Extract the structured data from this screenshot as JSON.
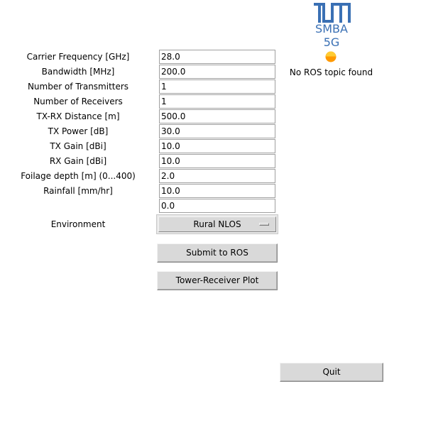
{
  "logo": {
    "line1": "SMBA",
    "line2": "5G",
    "color": "#3a70b4"
  },
  "status": {
    "text": "No ROS topic found",
    "indicator_color": "#ff9900"
  },
  "form": {
    "fields": [
      {
        "label": "Carrier Frequency [GHz]",
        "value": "28.0"
      },
      {
        "label": "Bandwidth [MHz]",
        "value": "200.0"
      },
      {
        "label": "Number of Transmitters",
        "value": "1"
      },
      {
        "label": "Number of Receivers",
        "value": "1"
      },
      {
        "label": "TX-RX Distance [m]",
        "value": "500.0"
      },
      {
        "label": "TX Power [dB]",
        "value": "30.0"
      },
      {
        "label": "TX Gain [dBi]",
        "value": "10.0"
      },
      {
        "label": "RX Gain [dBi]",
        "value": "10.0"
      },
      {
        "label": "Foilage depth [m] (0...400)",
        "value": "2.0"
      },
      {
        "label": "Rainfall [mm/hr]",
        "value": "10.0"
      },
      {
        "label": "",
        "value": "0.0"
      }
    ],
    "environment": {
      "label": "Environment",
      "selected": "Rural NLOS"
    }
  },
  "buttons": {
    "submit": "Submit to ROS",
    "plot": "Tower-Receiver Plot",
    "quit": "Quit"
  }
}
